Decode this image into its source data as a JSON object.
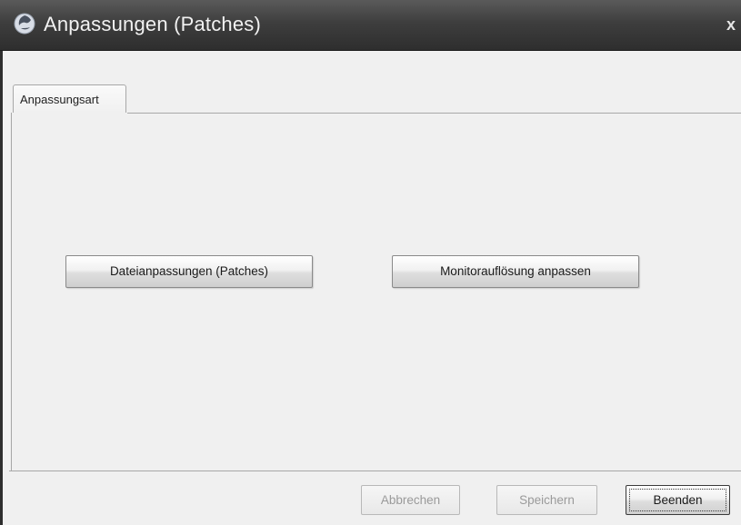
{
  "window": {
    "title": "Anpassungen (Patches)",
    "close_glyph": "x",
    "icon": "app-globe-icon"
  },
  "tabs": [
    {
      "label": "Anpassungsart",
      "selected": true
    }
  ],
  "actions": {
    "patches_label": "Dateianpassungen (Patches)",
    "monitor_label": "Monitorauflösung anpassen"
  },
  "footer": {
    "cancel_label": "Abbrechen",
    "save_label": "Speichern",
    "exit_label": "Beenden",
    "cancel_enabled": false,
    "save_enabled": false,
    "exit_focused": true
  },
  "colors": {
    "titlebar": "#3e3e3e",
    "window_bg": "#f0f0f0",
    "disabled_text": "#9a9a9a"
  }
}
